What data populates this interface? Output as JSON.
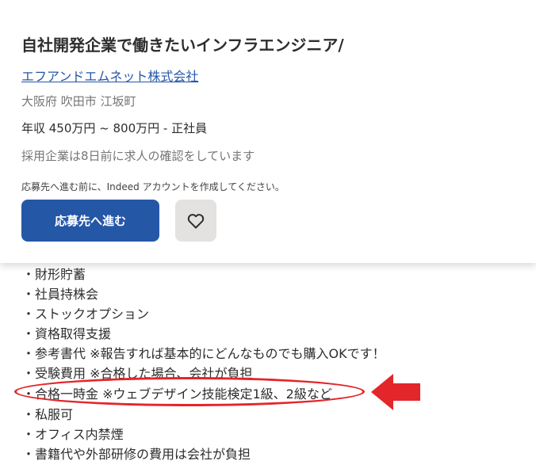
{
  "job": {
    "title": "自社開発企業で働きたいインフラエンジニア/",
    "company": "エフアンドエムネット株式会社",
    "location": "大阪府 吹田市 江坂町",
    "salary": "年収 450万円 ~ 800万円  - 正社員",
    "activity": "採用企業は8日前に求人の確認をしています",
    "account_note": "応募先へ進む前に、Indeed アカウントを作成してください。"
  },
  "actions": {
    "apply_label": "応募先へ進む",
    "save_icon": "heart-outline-icon"
  },
  "benefits": {
    "items": [
      "・財形貯蓄",
      "・社員持株会",
      "・ストックオプション",
      "・資格取得支援",
      "・参考書代 ※報告すれば基本的にどんなものでも購入OKです！",
      "・受験費用 ※合格した場合、会社が負担",
      "・合格一時金 ※ウェブデザイン技能検定1級、2級など",
      "・私服可",
      "・オフィス内禁煙",
      "・書籍代や外部研修の費用は会社が負担"
    ]
  },
  "annotation": {
    "color": "#e3262a",
    "highlighted_item": "・合格一時金 ※ウェブデザイン技能検定1級、2級など"
  },
  "colors": {
    "primary": "#2557a7",
    "secondary_button": "#e4e2e0",
    "text": "#2d2d2d",
    "muted_text": "#767676"
  }
}
